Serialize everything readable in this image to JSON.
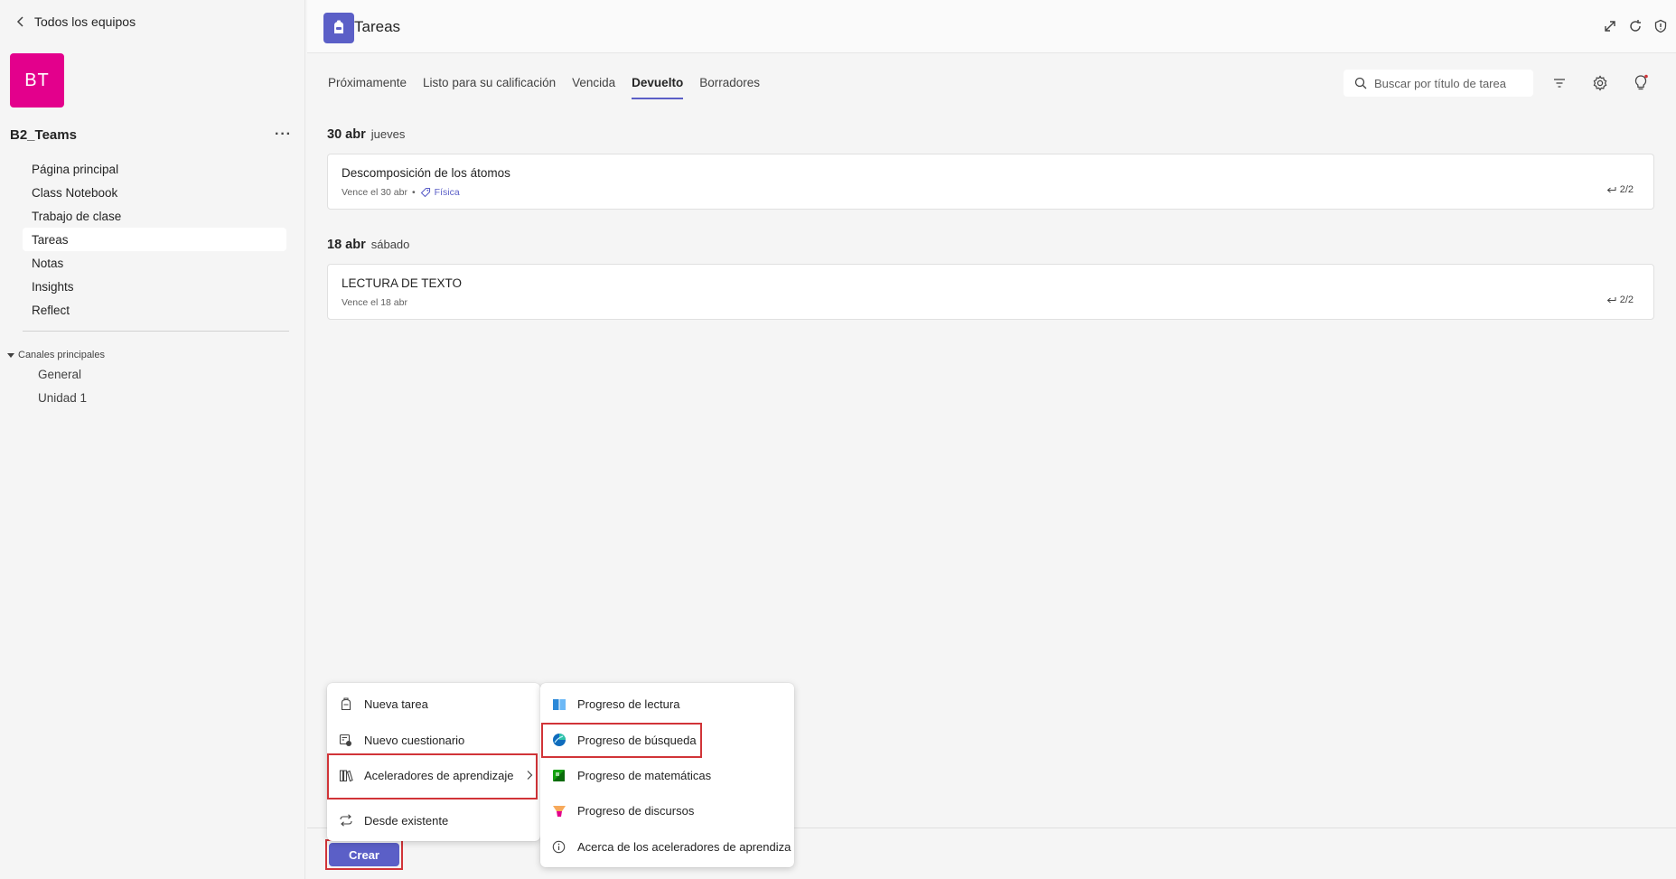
{
  "sidebar": {
    "back_label": "Todos los equipos",
    "team_initials": "BT",
    "team_name": "B2_Teams",
    "more": "···",
    "nav": [
      "Página principal",
      "Class Notebook",
      "Trabajo de clase",
      "Tareas",
      "Notas",
      "Insights",
      "Reflect"
    ],
    "active_nav": "Tareas",
    "channels_header": "Canales principales",
    "channels": [
      "General",
      "Unidad 1"
    ]
  },
  "app": {
    "title": "Tareas"
  },
  "tabs": [
    "Próximamente",
    "Listo para su calificación",
    "Vencida",
    "Devuelto",
    "Borradores"
  ],
  "active_tab": "Devuelto",
  "search": {
    "placeholder": "Buscar por título de tarea"
  },
  "groups": [
    {
      "date": "30 abr",
      "weekday": "jueves",
      "assignment": {
        "title": "Descomposición de los átomos",
        "due": "Vence el 30 abr",
        "separator": "•",
        "tag": "Física",
        "count": "2/2"
      }
    },
    {
      "date": "18 abr",
      "weekday": "sábado",
      "assignment": {
        "title": "LECTURA DE TEXTO",
        "due": "Vence el 18 abr",
        "count": "2/2"
      }
    }
  ],
  "create_button": "Crear",
  "create_menu": [
    "Nueva tarea",
    "Nuevo cuestionario",
    "Aceleradores de aprendizaje",
    "Desde existente"
  ],
  "accelerators_menu": [
    "Progreso de lectura",
    "Progreso de búsqueda",
    "Progreso de matemáticas",
    "Progreso de discursos",
    "Acerca de los aceleradores de aprendiza"
  ],
  "colors": {
    "accent": "#5b5fc7",
    "team_avatar": "#e3008c",
    "highlight": "#d13438"
  }
}
